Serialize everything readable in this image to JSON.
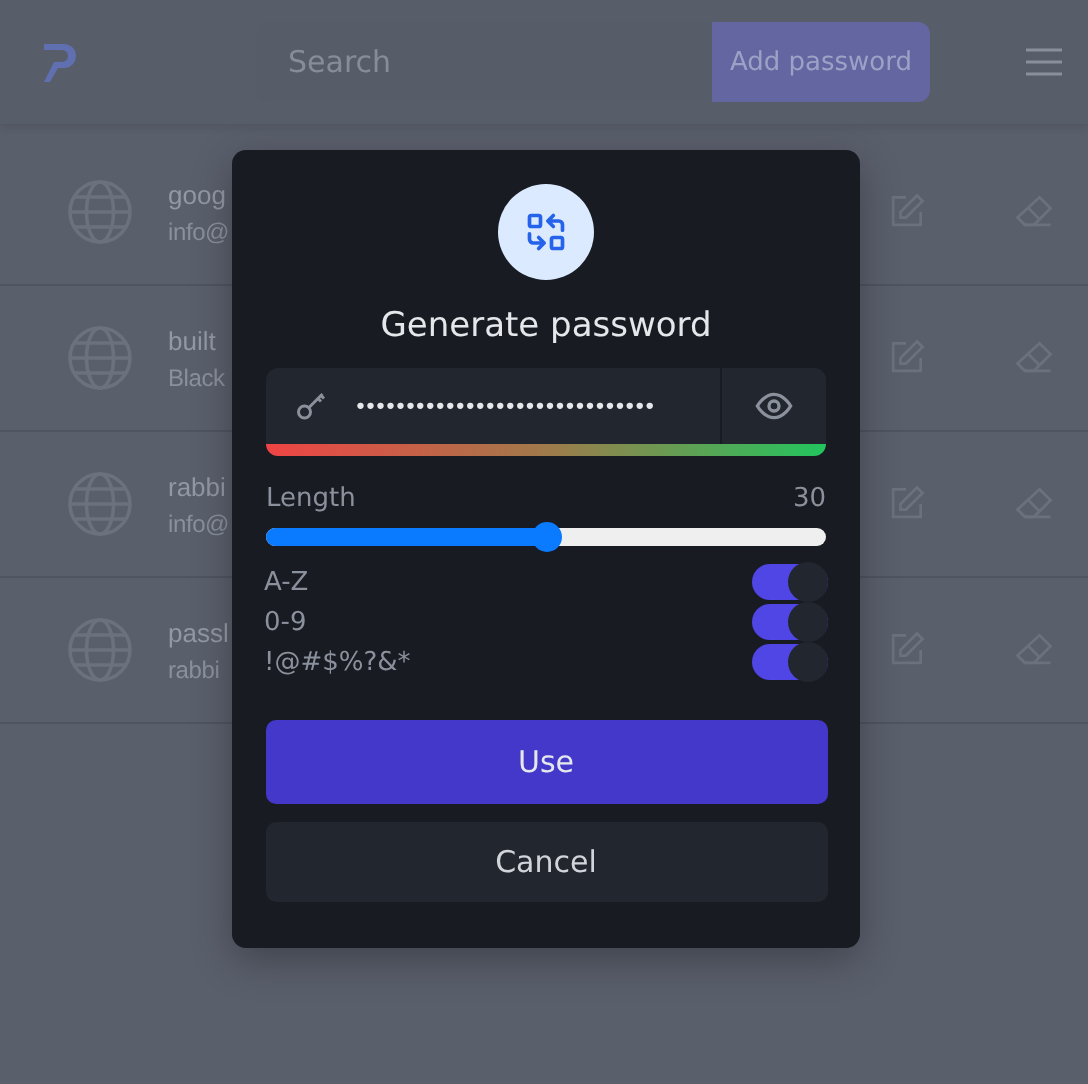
{
  "header": {
    "search": {
      "placeholder": "Search"
    },
    "add_button": "Add password"
  },
  "entries": [
    {
      "title": "goog",
      "subtitle": "info@"
    },
    {
      "title": "built",
      "subtitle": "Black"
    },
    {
      "title": "rabbi",
      "subtitle": "info@"
    },
    {
      "title": "passl",
      "subtitle": "rabbi"
    }
  ],
  "dialog": {
    "title": "Generate password",
    "password": {
      "value": "••••••••••••••••••••••••••••••"
    },
    "length": {
      "label": "Length",
      "reading": "30",
      "level": 0.5
    },
    "options": [
      {
        "label": "A-Z",
        "on": true
      },
      {
        "label": "0-9",
        "on": true
      },
      {
        "label": "!@#$%?&*",
        "on": true
      }
    ],
    "buttons": [
      {
        "label": "Use",
        "kind": "primary"
      },
      {
        "label": "Cancel",
        "kind": "secondary"
      }
    ]
  }
}
